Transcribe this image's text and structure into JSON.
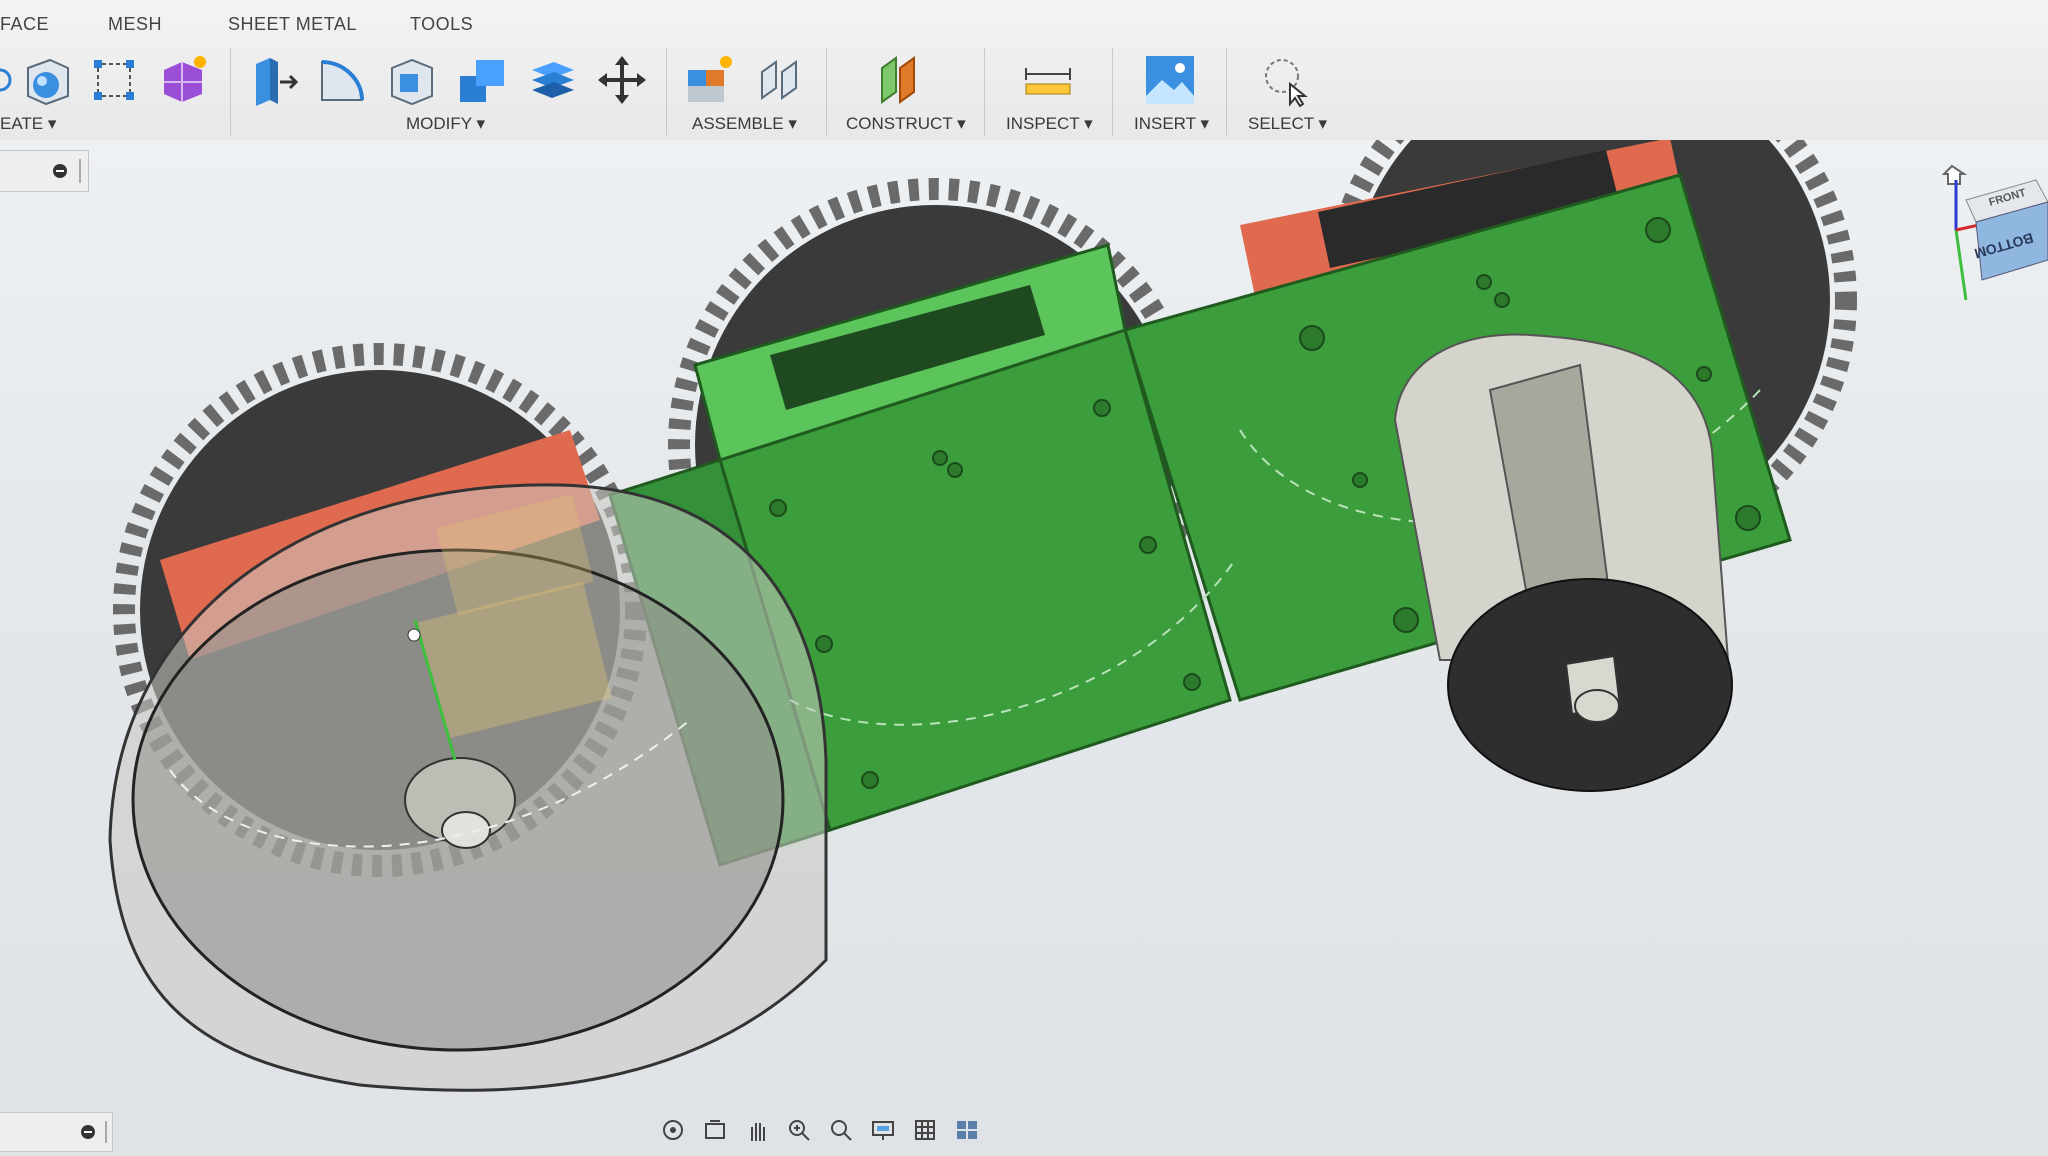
{
  "tabs": [
    "FACE",
    "MESH",
    "SHEET METAL",
    "TOOLS"
  ],
  "groups": {
    "create": "EATE",
    "modify": "MODIFY",
    "assemble": "ASSEMBLE",
    "construct": "CONSTRUCT",
    "inspect": "INSPECT",
    "insert": "INSERT",
    "select": "SELECT"
  },
  "viewcube": {
    "front": "FRONT",
    "bottom": "BOTTOM"
  },
  "colors": {
    "gear": "#3a3a3a",
    "body": "#3c9d3c",
    "motor_mount": "#e06a50",
    "cylinder": "#c9c9c2"
  }
}
